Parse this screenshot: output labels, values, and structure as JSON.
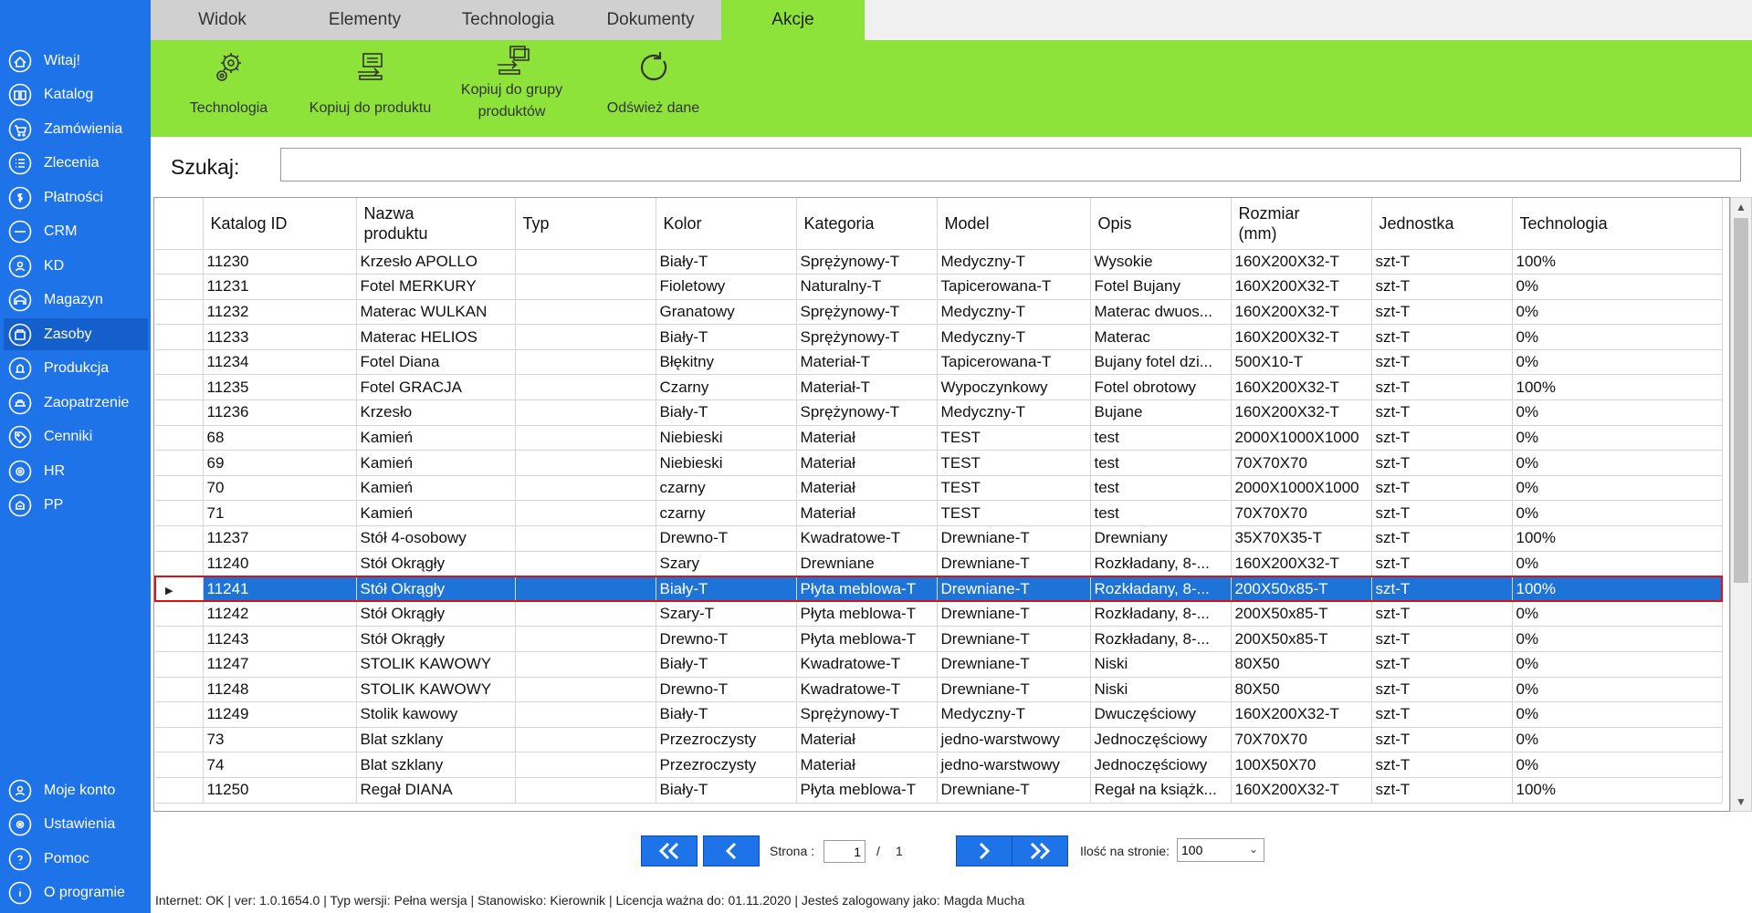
{
  "sidebar": {
    "items": [
      {
        "label": "Witaj!",
        "icon": "home-icon"
      },
      {
        "label": "Katalog",
        "icon": "book-icon"
      },
      {
        "label": "Zamówienia",
        "icon": "cart-icon"
      },
      {
        "label": "Zlecenia",
        "icon": "list-icon"
      },
      {
        "label": "Płatności",
        "icon": "dollar-icon"
      },
      {
        "label": "CRM",
        "icon": "crm-icon"
      },
      {
        "label": "KD",
        "icon": "user-icon"
      },
      {
        "label": "Magazyn",
        "icon": "warehouse-icon"
      },
      {
        "label": "Zasoby",
        "icon": "resources-icon"
      },
      {
        "label": "Produkcja",
        "icon": "production-icon"
      },
      {
        "label": "Zaopatrzenie",
        "icon": "supply-icon"
      },
      {
        "label": "Cenniki",
        "icon": "tag-icon"
      },
      {
        "label": "HR",
        "icon": "hr-icon"
      },
      {
        "label": "PP",
        "icon": "pp-icon"
      }
    ],
    "active_index": 8,
    "bottom": [
      {
        "label": "Moje konto",
        "icon": "account-icon"
      },
      {
        "label": "Ustawienia",
        "icon": "settings-icon"
      },
      {
        "label": "Pomoc",
        "icon": "help-icon"
      },
      {
        "label": "O programie",
        "icon": "info-icon"
      }
    ]
  },
  "tabs": [
    "Widok",
    "Elementy",
    "Technologia",
    "Dokumenty",
    "Akcje"
  ],
  "active_tab": "Akcje",
  "ribbon": {
    "technologia": "Technologia",
    "kopiuj_produkt": "Kopiuj do produktu",
    "kopiuj_grupa_1": "Kopiuj do grupy",
    "kopiuj_grupa_2": "produktów",
    "odswiez": "Odśwież dane"
  },
  "search": {
    "label": "Szukaj:",
    "value": ""
  },
  "table": {
    "headers": {
      "katalog_id": "Katalog ID",
      "nazwa_1": "Nazwa",
      "nazwa_2": "produktu",
      "typ": "Typ",
      "kolor": "Kolor",
      "kategoria": "Kategoria",
      "model": "Model",
      "opis": "Opis",
      "rozmiar_1": "Rozmiar",
      "rozmiar_2": "(mm)",
      "jednostka": "Jednostka",
      "technologia": "Technologia"
    },
    "rows": [
      [
        "11230",
        "Krzesło APOLLO",
        "",
        "Biały-T",
        "Sprężynowy-T",
        "Medyczny-T",
        "Wysokie",
        "160X200X32-T",
        "szt-T",
        "100%"
      ],
      [
        "11231",
        "Fotel MERKURY",
        "",
        "Fioletowy",
        "Naturalny-T",
        "Tapicerowana-T",
        "Fotel Bujany",
        "160X200X32-T",
        "szt-T",
        "0%"
      ],
      [
        "11232",
        "Materac WULKAN",
        "",
        "Granatowy",
        "Sprężynowy-T",
        "Medyczny-T",
        "Materac dwuos...",
        "160X200X32-T",
        "szt-T",
        "0%"
      ],
      [
        "11233",
        "Materac HELIOS",
        "",
        "Biały-T",
        "Sprężynowy-T",
        "Medyczny-T",
        "Materac",
        "160X200X32-T",
        "szt-T",
        "0%"
      ],
      [
        "11234",
        "Fotel Diana",
        "",
        "Błękitny",
        "Materiał-T",
        "Tapicerowana-T",
        "Bujany fotel dzi...",
        "500X10-T",
        "szt-T",
        "0%"
      ],
      [
        "11235",
        "Fotel GRACJA",
        "",
        "Czarny",
        "Materiał-T",
        "Wypoczynkowy",
        "Fotel obrotowy",
        "160X200X32-T",
        "szt-T",
        "100%"
      ],
      [
        "11236",
        "Krzesło",
        "",
        "Biały-T",
        "Sprężynowy-T",
        "Medyczny-T",
        "Bujane",
        "160X200X32-T",
        "szt-T",
        "0%"
      ],
      [
        "68",
        "Kamień",
        "",
        "Niebieski",
        "Materiał",
        "TEST",
        "test",
        "2000X1000X1000",
        "szt-T",
        "0%"
      ],
      [
        "69",
        "Kamień",
        "",
        "Niebieski",
        "Materiał",
        "TEST",
        "test",
        "70X70X70",
        "szt-T",
        "0%"
      ],
      [
        "70",
        "Kamień",
        "",
        "czarny",
        "Materiał",
        "TEST",
        "test",
        "2000X1000X1000",
        "szt-T",
        "0%"
      ],
      [
        "71",
        "Kamień",
        "",
        "czarny",
        "Materiał",
        "TEST",
        "test",
        "70X70X70",
        "szt-T",
        "0%"
      ],
      [
        "11237",
        "Stół 4-osobowy",
        "",
        "Drewno-T",
        "Kwadratowe-T",
        "Drewniane-T",
        "Drewniany",
        "35X70X35-T",
        "szt-T",
        "100%"
      ],
      [
        "11240",
        "Stół Okrągły",
        "",
        "Szary",
        "Drewniane",
        "Drewniane-T",
        "Rozkładany, 8-...",
        "160X200X32-T",
        "szt-T",
        "0%"
      ],
      [
        "11241",
        "Stół Okrągły",
        "",
        "Biały-T",
        "Płyta meblowa-T",
        "Drewniane-T",
        "Rozkładany, 8-...",
        "200X50x85-T",
        "szt-T",
        "100%"
      ],
      [
        "11242",
        "Stół Okrągły",
        "",
        "Szary-T",
        "Płyta meblowa-T",
        "Drewniane-T",
        "Rozkładany, 8-...",
        "200X50x85-T",
        "szt-T",
        "0%"
      ],
      [
        "11243",
        "Stół Okrągły",
        "",
        "Drewno-T",
        "Płyta meblowa-T",
        "Drewniane-T",
        "Rozkładany, 8-...",
        "200X50x85-T",
        "szt-T",
        "0%"
      ],
      [
        "11247",
        "STOLIK KAWOWY",
        "",
        "Biały-T",
        "Kwadratowe-T",
        "Drewniane-T",
        "Niski",
        "80X50",
        "szt-T",
        "0%"
      ],
      [
        "11248",
        "STOLIK KAWOWY",
        "",
        "Drewno-T",
        "Kwadratowe-T",
        "Drewniane-T",
        "Niski",
        "80X50",
        "szt-T",
        "0%"
      ],
      [
        "11249",
        "Stolik kawowy",
        "",
        "Biały-T",
        "Sprężynowy-T",
        "Medyczny-T",
        "Dwuczęściowy",
        "160X200X32-T",
        "szt-T",
        "0%"
      ],
      [
        "73",
        "Blat szklany",
        "",
        "Przezroczysty",
        "Materiał",
        "jedno-warstwowy",
        "Jednoczęściowy",
        "70X70X70",
        "szt-T",
        "0%"
      ],
      [
        "74",
        "Blat szklany",
        "",
        "Przezroczysty",
        "Materiał",
        "jedno-warstwowy",
        "Jednoczęściowy",
        "100X50X70",
        "szt-T",
        "0%"
      ],
      [
        "11250",
        "Regał DIANA",
        "",
        "Biały-T",
        "Płyta meblowa-T",
        "Drewniane-T",
        "Regał na książk...",
        "160X200X32-T",
        "szt-T",
        "100%"
      ]
    ],
    "selected_row": 13
  },
  "pager": {
    "strona_label": "Strona :",
    "page": "1",
    "separator": "/",
    "total": "1",
    "per_page_label": "Ilość na stronie:",
    "per_page": "100"
  },
  "status": "Internet: OK  |  ver: 1.0.1654.0  |  Typ wersji: Pełna wersja  |  Stanowisko: Kierownik  |  Licencja ważna do: 01.11.2020  |  Jesteś zalogowany jako: Magda Mucha",
  "colors": {
    "sidebar": "#1e73e8",
    "ribbon": "#8de33a",
    "selection": "#1e73d8",
    "selection_border": "#e01010"
  }
}
